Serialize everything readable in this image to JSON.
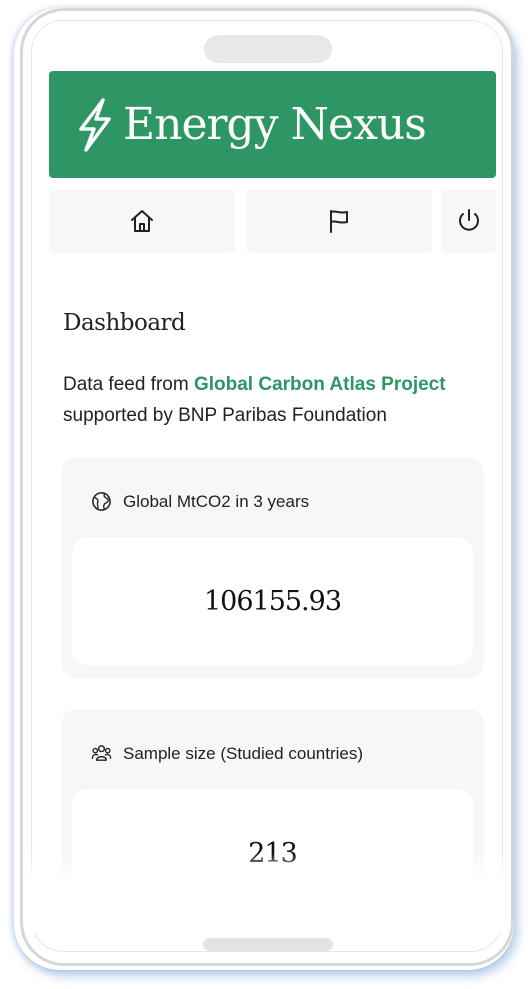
{
  "app": {
    "title": "Energy Nexus",
    "logo_icon": "lightning-bolt-icon",
    "brand_color": "#2e9565"
  },
  "nav": [
    {
      "icon": "home-icon"
    },
    {
      "icon": "flag-icon"
    },
    {
      "icon": "power-icon"
    }
  ],
  "page": {
    "title": "Dashboard",
    "feed_prefix": "Data feed from ",
    "feed_link": "Global Carbon Atlas Project",
    "feed_suffix": "supported by BNP Paribas Foundation"
  },
  "cards": [
    {
      "icon": "globe-icon",
      "label": "Global MtCO2 in 3 years",
      "value": "106155.93"
    },
    {
      "icon": "users-icon",
      "label": "Sample size (Studied countries)",
      "value": "213"
    }
  ]
}
